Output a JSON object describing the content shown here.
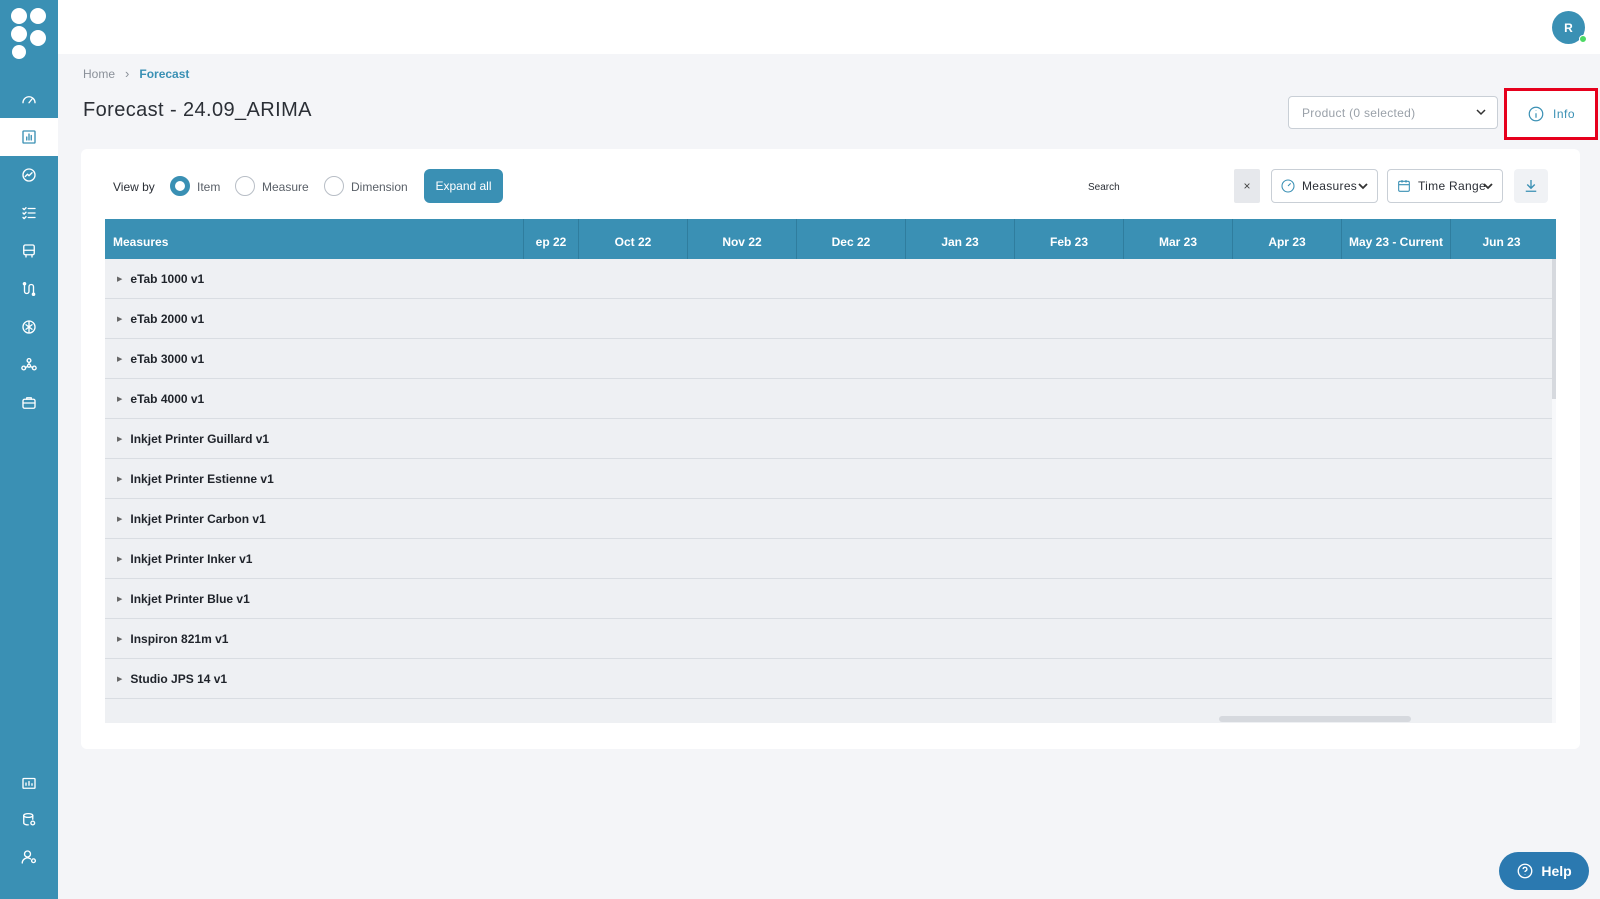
{
  "user": {
    "initial": "R"
  },
  "breadcrumb": {
    "home": "Home",
    "current": "Forecast"
  },
  "page": {
    "title": "Forecast - 24.09_ARIMA"
  },
  "filters": {
    "product_placeholder": "Product (0 selected)"
  },
  "info": {
    "label": "Info"
  },
  "toolbar": {
    "view_by_label": "View by",
    "view_options": [
      "Item",
      "Measure",
      "Dimension"
    ],
    "selected_view": "Item",
    "expand_label": "Expand all",
    "search_label": "Search",
    "clear_symbol": "×",
    "measures_label": "Measures",
    "time_range_label": "Time Range"
  },
  "table": {
    "first_column": "Measures",
    "months": [
      "ep 22",
      "Oct 22",
      "Nov 22",
      "Dec 22",
      "Jan 23",
      "Feb 23",
      "Mar 23",
      "Apr 23",
      "May 23 - Current",
      "Jun 23"
    ],
    "rows": [
      "eTab 1000 v1",
      "eTab 2000 v1",
      "eTab 3000 v1",
      "eTab 4000 v1",
      "Inkjet Printer Guillard v1",
      "Inkjet Printer Estienne v1",
      "Inkjet Printer Carbon v1",
      "Inkjet Printer Inker v1",
      "Inkjet Printer Blue v1",
      "Inspiron 821m v1",
      "Studio JPS 14 v1"
    ]
  },
  "help": {
    "label": "Help"
  },
  "colors": {
    "brand": "#3a90b4",
    "highlight": "#e6001d"
  }
}
